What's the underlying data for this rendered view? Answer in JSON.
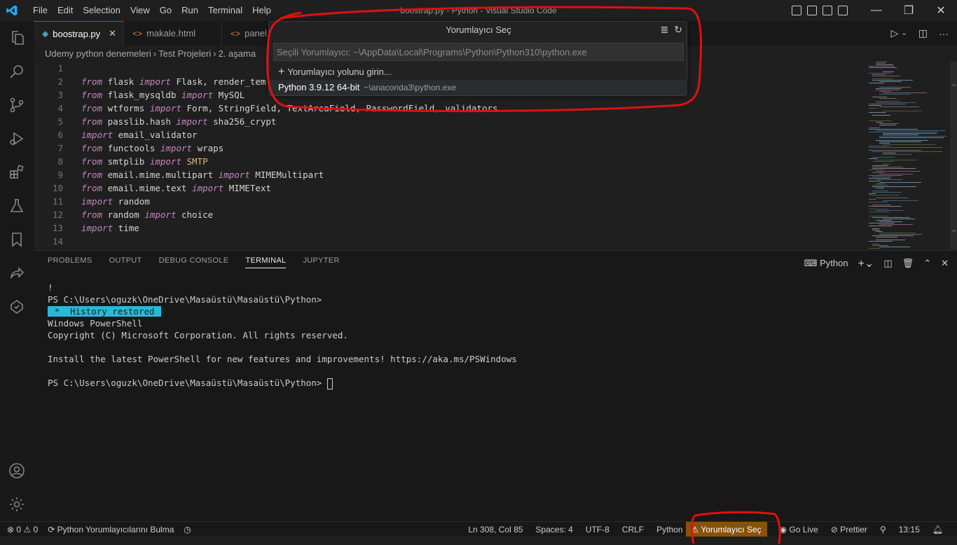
{
  "window": {
    "title": "boostrap.py - Python - Visual Studio Code",
    "menu": [
      "File",
      "Edit",
      "Selection",
      "View",
      "Go",
      "Run",
      "Terminal",
      "Help"
    ]
  },
  "tabs": [
    {
      "label": "boostrap.py",
      "active": true,
      "icon": "python-file-icon"
    },
    {
      "label": "makale.html",
      "active": false,
      "icon": "html-file-icon"
    },
    {
      "label": "panel.ht",
      "active": false,
      "icon": "html-file-icon"
    }
  ],
  "breadcrumb": [
    "Udemy python denemeleri",
    "Test Projeleri",
    "2. aşama"
  ],
  "editor": {
    "lines": [
      {
        "n": "1",
        "tokens": []
      },
      {
        "n": "2",
        "tokens": [
          [
            "kw",
            "from"
          ],
          [
            "id",
            " flask "
          ],
          [
            "kw",
            "import"
          ],
          [
            "id",
            " Flask, render_tem"
          ]
        ]
      },
      {
        "n": "3",
        "tokens": [
          [
            "kw",
            "from"
          ],
          [
            "id",
            " flask_mysqldb "
          ],
          [
            "kw",
            "import"
          ],
          [
            "id",
            " MySQL"
          ]
        ]
      },
      {
        "n": "4",
        "tokens": [
          [
            "kw",
            "from"
          ],
          [
            "id",
            " wtforms "
          ],
          [
            "kw",
            "import"
          ],
          [
            "id",
            " Form, StringField, TextAreaField, PasswordField, validators"
          ]
        ]
      },
      {
        "n": "5",
        "tokens": [
          [
            "kw",
            "from"
          ],
          [
            "id",
            " passlib.hash "
          ],
          [
            "kw",
            "import"
          ],
          [
            "id",
            " sha256_crypt"
          ]
        ]
      },
      {
        "n": "6",
        "tokens": [
          [
            "kw",
            "import"
          ],
          [
            "id",
            " email_validator"
          ]
        ]
      },
      {
        "n": "7",
        "tokens": [
          [
            "kw",
            "from"
          ],
          [
            "id",
            " functools "
          ],
          [
            "kw",
            "import"
          ],
          [
            "id",
            " wraps"
          ]
        ]
      },
      {
        "n": "8",
        "tokens": [
          [
            "kw",
            "from"
          ],
          [
            "id",
            " smtplib "
          ],
          [
            "kw",
            "import"
          ],
          [
            "cls",
            " SMTP"
          ]
        ]
      },
      {
        "n": "9",
        "tokens": [
          [
            "kw",
            "from"
          ],
          [
            "id",
            " email.mime.multipart "
          ],
          [
            "kw",
            "import"
          ],
          [
            "id",
            " MIMEMultipart"
          ]
        ]
      },
      {
        "n": "10",
        "tokens": [
          [
            "kw",
            "from"
          ],
          [
            "id",
            " email.mime.text "
          ],
          [
            "kw",
            "import"
          ],
          [
            "id",
            " MIMEText"
          ]
        ]
      },
      {
        "n": "11",
        "tokens": [
          [
            "kw",
            "import"
          ],
          [
            "id",
            " random"
          ]
        ]
      },
      {
        "n": "12",
        "tokens": [
          [
            "kw",
            "from"
          ],
          [
            "id",
            " random "
          ],
          [
            "kw",
            "import"
          ],
          [
            "id",
            " choice"
          ]
        ]
      },
      {
        "n": "13",
        "tokens": [
          [
            "kw",
            "import"
          ],
          [
            "id",
            " time"
          ]
        ]
      },
      {
        "n": "14",
        "tokens": []
      }
    ]
  },
  "quickpick": {
    "title": "Yorumlayıcı Seç",
    "placeholder": "Seçili Yorumlayıcı: ~\\AppData\\Local\\Programs\\Python\\Python310\\python.exe",
    "add_label": "Yorumlayıcı yolunu girin...",
    "items": [
      {
        "label": "Python 3.9.12 64-bit",
        "desc": "~\\anaconda3\\python.exe"
      }
    ]
  },
  "panel": {
    "tabs": [
      "PROBLEMS",
      "OUTPUT",
      "DEBUG CONSOLE",
      "TERMINAL",
      "JUPYTER"
    ],
    "active_tab": "TERMINAL",
    "terminal_name": "Python",
    "lines": [
      "!",
      "PS C:\\Users\\oguzk\\OneDrive\\Masaüstü\\Masaüstü\\Python>",
      " *  History restored ",
      "Windows PowerShell",
      "Copyright (C) Microsoft Corporation. All rights reserved.",
      "",
      "Install the latest PowerShell for new features and improvements! https://aka.ms/PSWindows",
      "",
      "PS C:\\Users\\oguzk\\OneDrive\\Masaüstü\\Masaüstü\\Python> "
    ]
  },
  "status": {
    "errors": "0",
    "warnings": "0",
    "finding": "Python Yorumlayıcılarını Bulma",
    "position": "Ln 308, Col 85",
    "spaces": "Spaces: 4",
    "encoding": "UTF-8",
    "eol": "CRLF",
    "language": "Python",
    "interpreter": "Yorumlayıcı Seç",
    "golive": "Go Live",
    "prettier": "Prettier",
    "time": "13:15"
  },
  "colors": {
    "accent": "#0078d4",
    "keyword": "#c586c0",
    "warning_bg": "#89510a",
    "annotation": "#e01010"
  }
}
